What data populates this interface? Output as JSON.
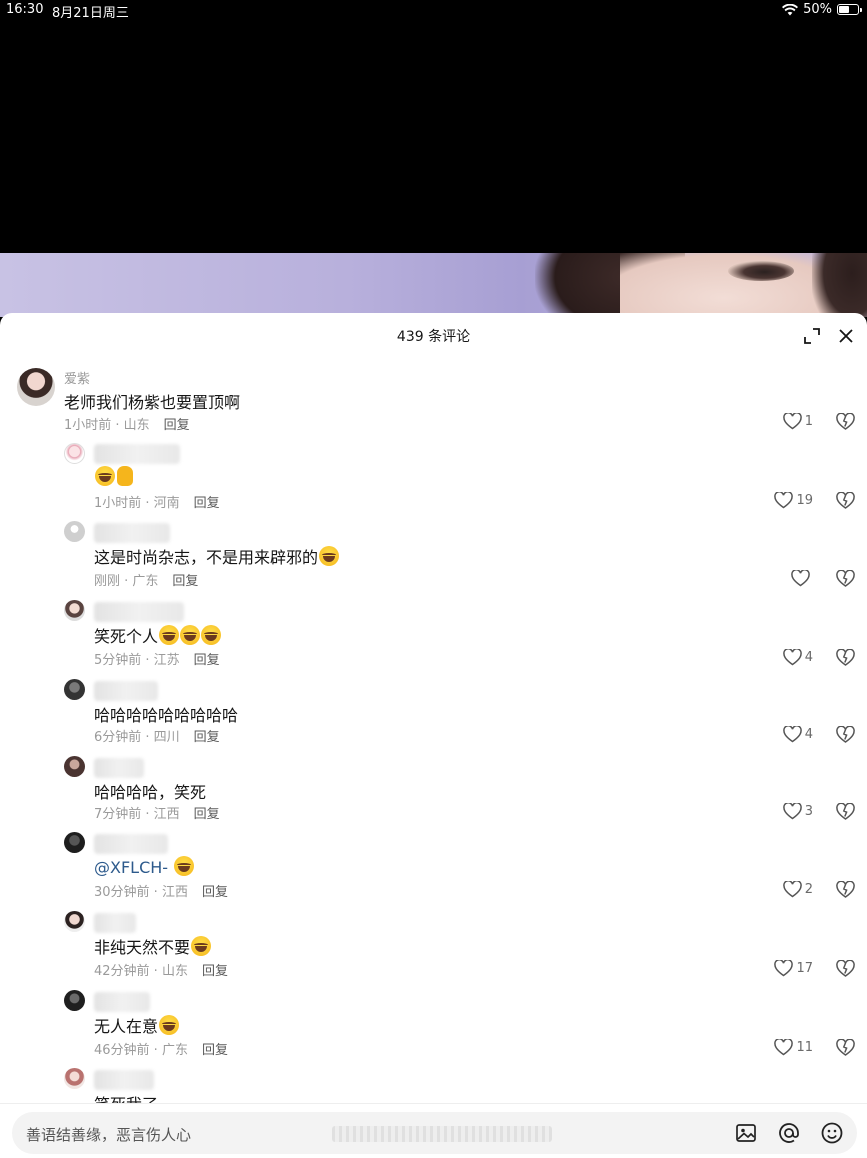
{
  "status_bar": {
    "time": "16:30",
    "date": "8月21日周三",
    "battery": "50%"
  },
  "sheet": {
    "title": "439 条评论"
  },
  "comments": [
    {
      "username": "爱紫",
      "content": "老师我们杨紫也要置顶啊",
      "meta": "1小时前 · 山东",
      "reply": "回复",
      "likes": "1"
    },
    {
      "username": "",
      "content": "",
      "meta": "1小时前 · 河南",
      "reply": "回复",
      "likes": "19"
    },
    {
      "username": "",
      "content": "这是时尚杂志，不是用来辟邪的",
      "meta": "刚刚 · 广东",
      "reply": "回复",
      "likes": ""
    },
    {
      "username": "",
      "content": "笑死个人",
      "meta": "5分钟前 · 江苏",
      "reply": "回复",
      "likes": "4"
    },
    {
      "username": "",
      "content": "哈哈哈哈哈哈哈哈哈",
      "meta": "6分钟前 · 四川",
      "reply": "回复",
      "likes": "4"
    },
    {
      "username": "",
      "content": "哈哈哈哈，笑死",
      "meta": "7分钟前 · 江西",
      "reply": "回复",
      "likes": "3"
    },
    {
      "username": "",
      "content": "@XFLCH- ",
      "meta": "30分钟前 · 江西",
      "reply": "回复",
      "likes": "2"
    },
    {
      "username": "",
      "content": "非纯天然不要",
      "meta": "42分钟前 · 山东",
      "reply": "回复",
      "likes": "17"
    },
    {
      "username": "",
      "content": "无人在意",
      "meta": "46分钟前 · 广东",
      "reply": "回复",
      "likes": "11"
    },
    {
      "username": "",
      "content": "笑死我了",
      "meta": "",
      "reply": "",
      "likes": ""
    }
  ],
  "input": {
    "placeholder": "善语结善缘，恶言伤人心"
  },
  "icons": [
    "wifi-icon",
    "battery-icon",
    "expand-icon",
    "close-icon",
    "heart-icon",
    "dislike-icon",
    "image-icon",
    "at-icon",
    "emoji-icon"
  ]
}
